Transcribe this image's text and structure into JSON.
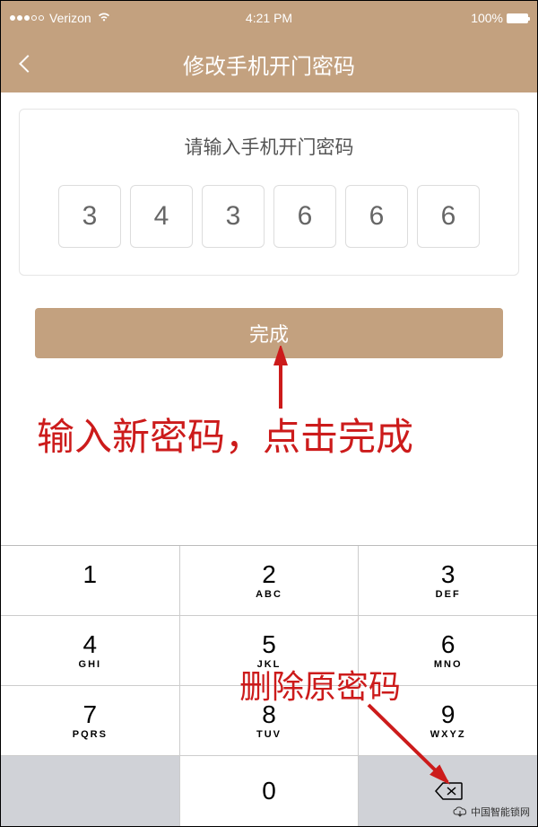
{
  "status": {
    "carrier": "Verizon",
    "time": "4:21 PM",
    "battery": "100%"
  },
  "nav": {
    "title": "修改手机开门密码"
  },
  "content": {
    "prompt": "请输入手机开门密码",
    "pin": [
      "3",
      "4",
      "3",
      "6",
      "6",
      "6"
    ]
  },
  "buttons": {
    "done": "完成"
  },
  "annotations": {
    "line1": "输入新密码，点击完成",
    "line2": "删除原密码"
  },
  "keypad": {
    "keys": [
      [
        {
          "d": "1",
          "l": ""
        },
        {
          "d": "2",
          "l": "ABC"
        },
        {
          "d": "3",
          "l": "DEF"
        }
      ],
      [
        {
          "d": "4",
          "l": "GHI"
        },
        {
          "d": "5",
          "l": "JKL"
        },
        {
          "d": "6",
          "l": "MNO"
        }
      ],
      [
        {
          "d": "7",
          "l": "PQRS"
        },
        {
          "d": "8",
          "l": "TUV"
        },
        {
          "d": "9",
          "l": "WXYZ"
        }
      ]
    ],
    "zero": "0"
  },
  "watermark": "中国智能锁网"
}
